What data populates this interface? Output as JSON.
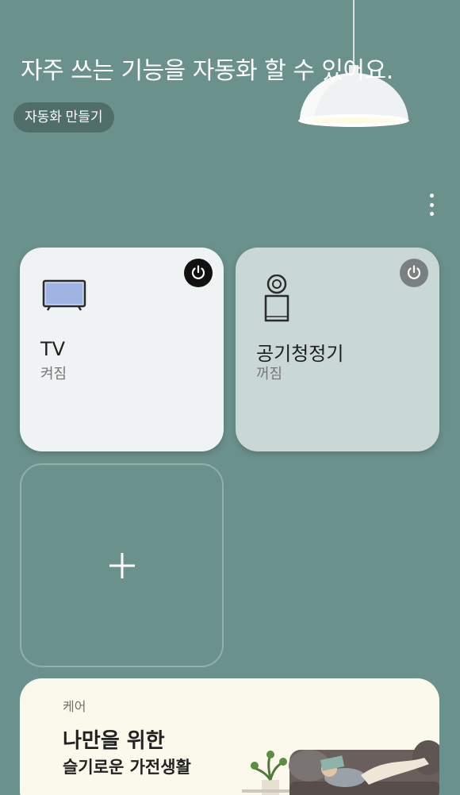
{
  "header": {
    "headline": "자주 쓰는 기능을 자동화 할 수 있어요.",
    "create_button_label": "자동화 만들기"
  },
  "devices": [
    {
      "name": "TV",
      "status": "켜짐",
      "power": "on",
      "icon": "tv-icon"
    },
    {
      "name": "공기청정기",
      "status": "꺼짐",
      "power": "off",
      "icon": "air-purifier-icon"
    }
  ],
  "add_card": {
    "icon": "plus-icon"
  },
  "care_banner": {
    "label": "케어",
    "title": "나만을 위한",
    "subtitle": "슬기로운 가전생활"
  },
  "colors": {
    "background": "#6b918c",
    "card_on": "#f0f3f4",
    "card_off": "#c9d7d5",
    "button": "#4f6e69",
    "banner": "#fbf9ec"
  }
}
